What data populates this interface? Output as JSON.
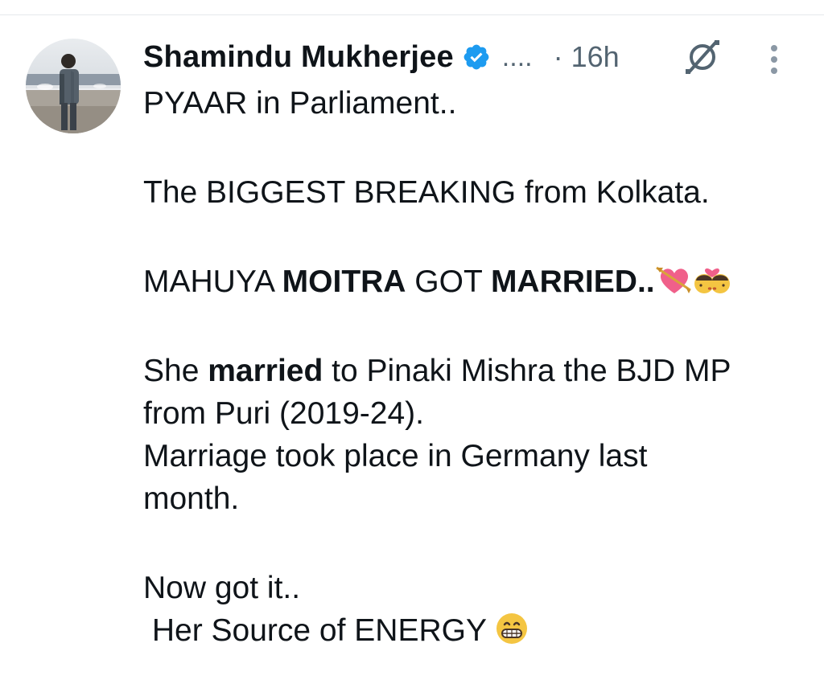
{
  "tweet": {
    "author": {
      "display_name": "Shamindu Mukherjee",
      "handle_truncated": "....",
      "verified": true
    },
    "time": "· 16h",
    "body": {
      "p1": "PYAAR in Parliament..",
      "p2": "The BIGGEST BREAKING from Kolkata.",
      "p3": {
        "t1": "MAHUYA ",
        "t2": "MOITRA",
        "t3": " GOT ",
        "t4": "MARRIED",
        "t5": ".."
      },
      "p4": {
        "t1": "She ",
        "t2": "married",
        "t3": " to Pinaki Mishra the BJD MP"
      },
      "p4_l2": "from Puri (2019-24).",
      "p5_l1": "Marriage took place in Germany last",
      "p5_l2": "month.",
      "p6_l1": "Now got it..",
      "p6_l2": " Her Source of ENERGY "
    },
    "icons": {
      "verified": "verified-badge-icon",
      "grok": "grok-icon",
      "more": "more-vertical-icon",
      "emoji_1": "heart-with-arrow-emoji",
      "emoji_2": "kiss-couple-emoji",
      "emoji_3": "grinning-face-emoji"
    },
    "colors": {
      "text": "#0f1419",
      "secondary": "#536471",
      "verified_blue": "#1d9bf0"
    }
  }
}
